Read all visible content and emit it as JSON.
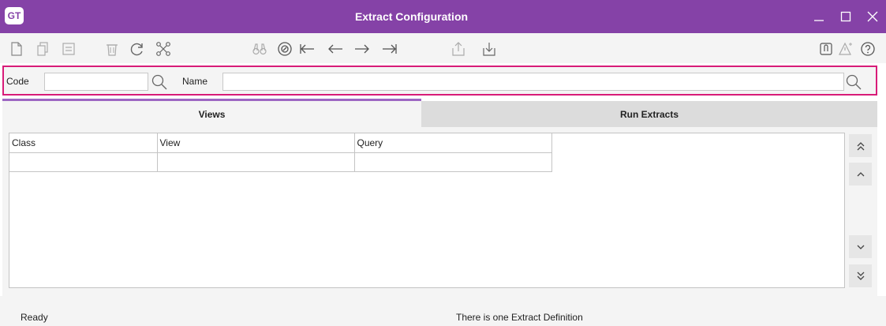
{
  "window": {
    "logo": "GT",
    "title": "Extract Configuration",
    "controls": [
      "minimize-icon",
      "maximize-icon",
      "close-icon"
    ]
  },
  "toolbar": {
    "icons": [
      "new-document-icon",
      "copy-icon",
      "save-icon",
      "delete-icon",
      "refresh-icon",
      "network-icon",
      "binoculars-icon",
      "compass-icon",
      "first-record-icon",
      "previous-record-icon",
      "next-record-icon",
      "last-record-icon",
      "export-icon",
      "import-icon",
      "attachment-icon",
      "warning-icon",
      "help-icon"
    ]
  },
  "search": {
    "code_label": "Code",
    "code_value": "",
    "name_label": "Name",
    "name_value": ""
  },
  "tabs": [
    {
      "label": "Views",
      "active": true
    },
    {
      "label": "Run Extracts",
      "active": false
    }
  ],
  "grid": {
    "columns": [
      "Class",
      "View",
      "Query"
    ],
    "rows": [
      [
        "",
        "",
        ""
      ]
    ]
  },
  "nav_buttons": [
    "move-top-icon",
    "move-up-icon",
    "move-down-icon",
    "move-bottom-icon"
  ],
  "status": {
    "left": "Ready",
    "middle": "There is one Extract Definition"
  },
  "colors": {
    "titlebar": "#8542a7",
    "highlight_border": "#d81b78",
    "active_tab_accent": "#9d66c2"
  }
}
